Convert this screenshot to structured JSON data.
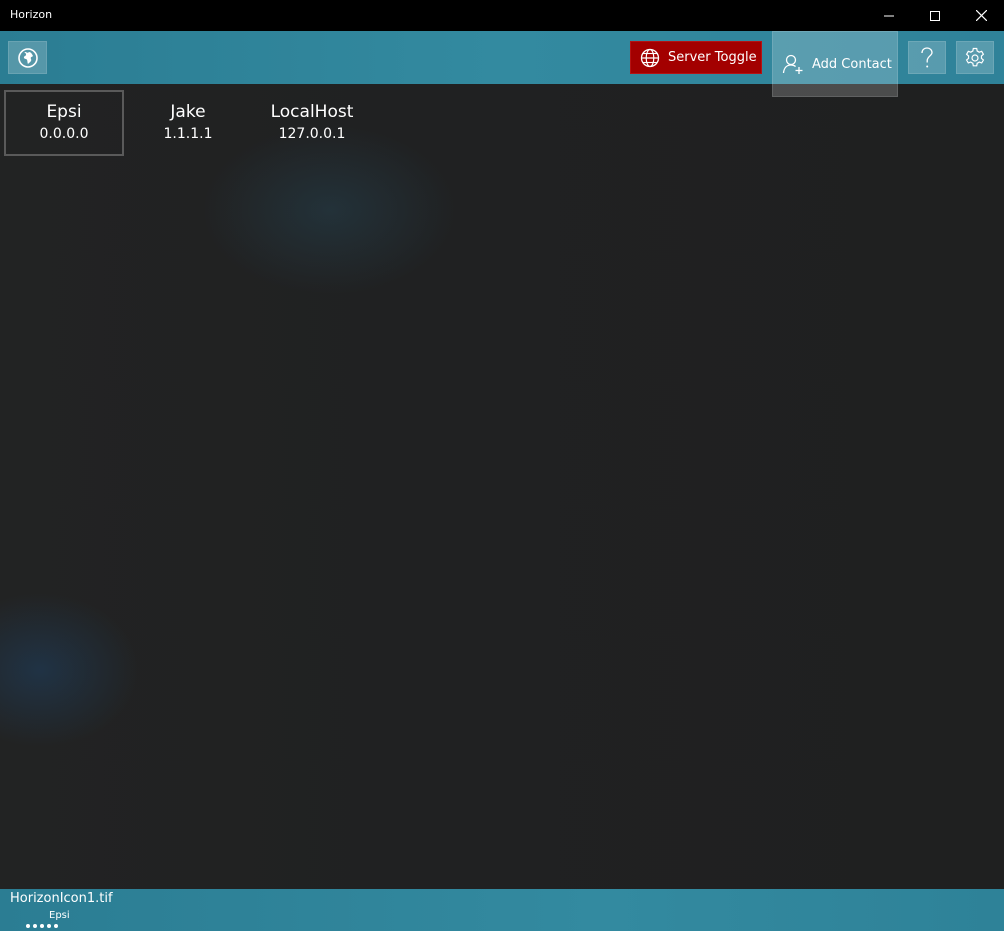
{
  "window": {
    "title": "Horizon"
  },
  "titlebar_controls": {
    "minimize_icon": "minimize-icon",
    "maximize_icon": "maximize-icon",
    "close_icon": "close-icon"
  },
  "toolbar": {
    "globe_icon": "globe-icon",
    "server_toggle_label": "Server Toggle",
    "server_toggle_color": "#a30000",
    "add_contact_label": "Add Contact",
    "help_icon": "question-mark-icon",
    "settings_icon": "gear-icon",
    "accent_color": "#338aa0"
  },
  "contacts": [
    {
      "name": "Epsi",
      "ip": "0.0.0.0",
      "selected": true
    },
    {
      "name": "Jake",
      "ip": "1.1.1.1",
      "selected": false
    },
    {
      "name": "LocalHost",
      "ip": "127.0.0.1",
      "selected": false
    }
  ],
  "statusbar": {
    "file": "HorizonIcon1.tif",
    "user": "Epsi"
  }
}
